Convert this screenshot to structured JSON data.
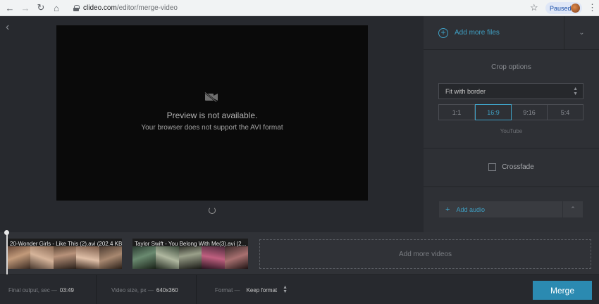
{
  "browser": {
    "url_host": "clideo.com",
    "url_path": "/editor/merge-video",
    "paused_label": "Paused",
    "icons": {
      "back": "arrow-left-icon",
      "forward": "arrow-right-icon",
      "reload": "reload-icon",
      "home": "home-icon",
      "lock": "lock-icon",
      "star": "star-icon",
      "menu": "kebab-menu-icon"
    }
  },
  "preview": {
    "title": "Preview is not available.",
    "subtitle": "Your browser does not support the AVI format"
  },
  "panel": {
    "add_files_label": "Add more files",
    "crop_title": "Crop options",
    "crop_selected": "Fit with border",
    "ratios": [
      {
        "label": "1:1",
        "active": false
      },
      {
        "label": "16:9",
        "active": true
      },
      {
        "label": "9:16",
        "active": false
      },
      {
        "label": "5:4",
        "active": false
      }
    ],
    "preset_label": "YouTube",
    "crossfade_label": "Crossfade",
    "crossfade_checked": false,
    "add_audio_label": "Add audio"
  },
  "timeline": {
    "clips": [
      {
        "label": "20-Wonder Girls - Like This (2).avi (202.4 KB)"
      },
      {
        "label": "Taylor Swift - You Belong With Me(3).avi (2..."
      }
    ],
    "add_videos_label": "Add more videos"
  },
  "footer": {
    "final_output_label": "Final output, sec —",
    "final_output_value": "03:49",
    "video_size_label": "Video size, px —",
    "video_size_value": "640x360",
    "format_label": "Format —",
    "format_value": "Keep format",
    "merge_label": "Merge"
  },
  "colors": {
    "accent": "#3fa0c4",
    "merge_button": "#2b8ab1",
    "background": "#27292e",
    "panel": "#2e3035"
  }
}
